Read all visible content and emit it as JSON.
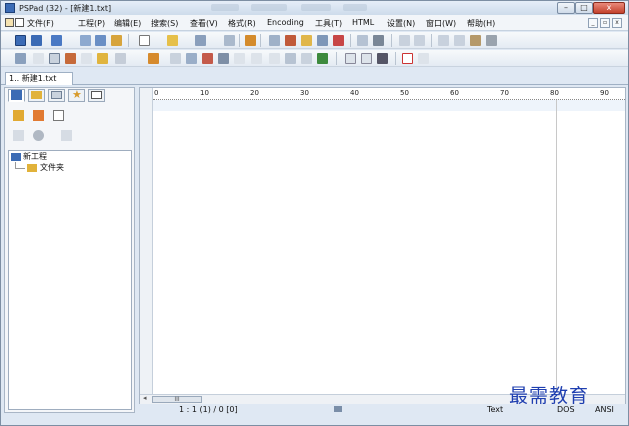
{
  "window": {
    "title": "PSPad (32) - [新建1.txt]",
    "controls": {
      "minimize": "–",
      "maximize": "□",
      "close": "x"
    }
  },
  "menubar": {
    "items": [
      "文件(F)",
      "工程(P)",
      "编辑(E)",
      "搜索(S)",
      "查看(V)",
      "格式(R)",
      "Encoding",
      "工具(T)",
      "HTML",
      "设置(N)",
      "窗口(W)",
      "帮助(H)"
    ],
    "mdi_controls": {
      "minimize": "_",
      "restore": "▫",
      "close": "x"
    }
  },
  "document_tab": {
    "label": "1.. 新建1.txt"
  },
  "project_tree": {
    "root": "新工程",
    "child": "文件夹"
  },
  "ruler": {
    "labels": [
      "0",
      "10",
      "20",
      "30",
      "40",
      "50",
      "60",
      "70",
      "80",
      "90"
    ]
  },
  "hscroll": {
    "thumb": "III"
  },
  "statusbar": {
    "position": "1 : 1 (1) / 0  [0]",
    "mode": "Text",
    "line_end": "DOS",
    "encoding": "ANSI"
  },
  "watermark": "最需教育",
  "colors": {
    "accent": "#3b6bb5",
    "close_button": "#c3412c"
  },
  "icons": {
    "toolbar1": [
      "new-icon",
      "open-icon",
      "save-icon",
      "print-icon",
      "copy-icon",
      "paste-icon",
      "undo-icon",
      "redo-icon",
      "find-icon",
      "replace-icon",
      "cut-icon",
      "delete-icon"
    ],
    "toolbar2": [
      "line-numbers-icon",
      "pilcrow-icon",
      "color-icon",
      "lock-icon",
      "html-icon",
      "arrow-icon"
    ],
    "panel_tabs": [
      "project-icon",
      "folder-icon",
      "list-icon",
      "star-icon",
      "window-icon"
    ]
  }
}
